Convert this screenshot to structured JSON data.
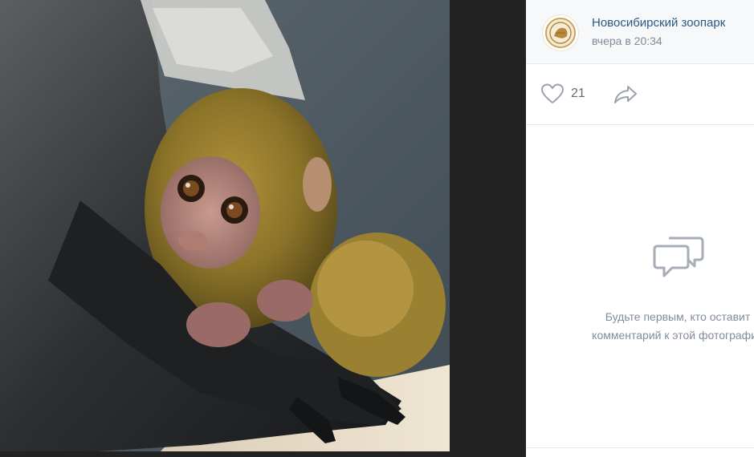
{
  "photo": {
    "description_icon": "photo",
    "alt": ""
  },
  "owner": {
    "name": "Новосибирский зоопарк",
    "time": "вчера в 20:34",
    "avatar_icon": "zoo-logo-icon"
  },
  "actions": {
    "like_count": "21",
    "like_icon": "heart-icon",
    "share_icon": "share-arrow-icon"
  },
  "comments": {
    "empty_line1": "Будьте первым, кто оставит",
    "empty_line2": "комментарий к этой фотографии",
    "icon": "comment-bubbles-icon"
  },
  "colors": {
    "link": "#2a5885",
    "muted": "#818c99",
    "icon": "#99a2ad",
    "background": "#ffffff",
    "overlay": "#222222"
  }
}
